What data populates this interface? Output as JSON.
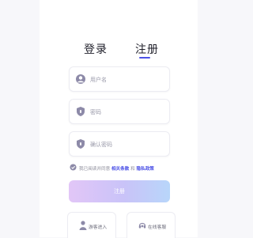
{
  "tabs": {
    "login": "登录",
    "register": "注册",
    "active": "register"
  },
  "fields": {
    "username": {
      "placeholder": "用户名",
      "value": "",
      "icon": "user-circle-icon"
    },
    "password": {
      "placeholder": "密码",
      "value": "",
      "icon": "shield-icon"
    },
    "confirm": {
      "placeholder": "确认密码",
      "value": "",
      "icon": "shield-icon"
    }
  },
  "agreement": {
    "prefix": "我已阅读并同意",
    "terms": "相关条款",
    "conjunction": "和",
    "privacy": "隐私政策",
    "checked": true
  },
  "submit_label": "注册",
  "alt_actions": {
    "guest": {
      "label": "游客进入",
      "icon": "person-icon"
    },
    "support": {
      "label": "在线客服",
      "icon": "headset-icon"
    }
  },
  "colors": {
    "accent": "#4b50e6",
    "button_gradient": [
      "#e2c6f7",
      "#c9c3f8",
      "#b8d6fa"
    ],
    "icon": "#8d8aa8"
  }
}
